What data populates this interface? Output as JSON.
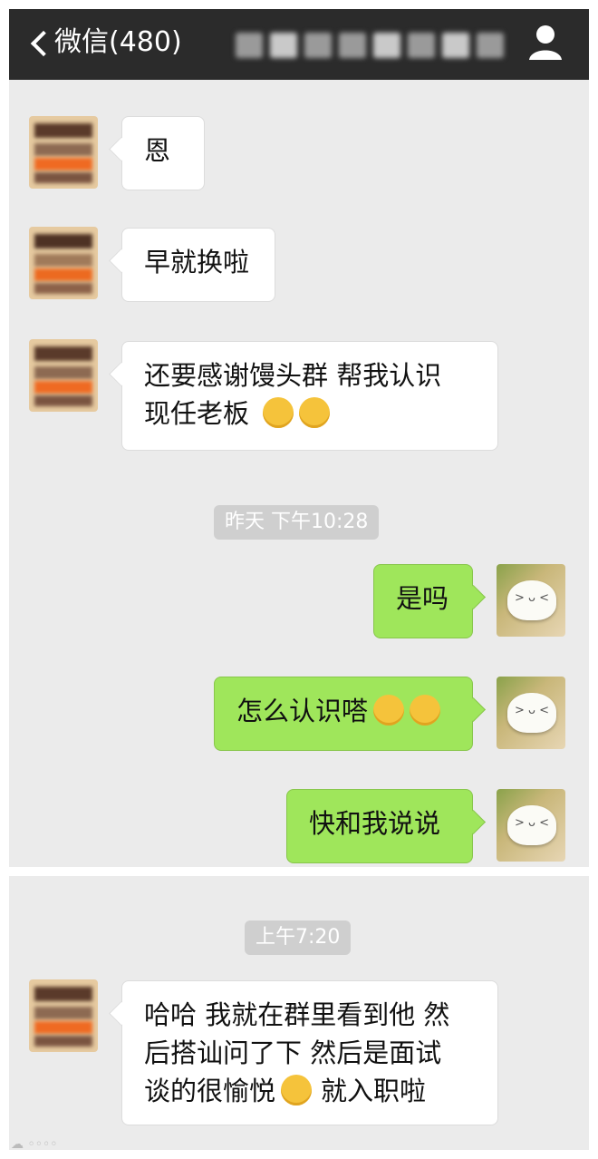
{
  "nav": {
    "back_label": "微信(480)",
    "icons": {
      "back": "chevron-left-icon",
      "profile": "user-icon"
    }
  },
  "messages": [
    {
      "side": "left",
      "text": "恩"
    },
    {
      "side": "left",
      "text": "早就换啦"
    },
    {
      "side": "left",
      "line1": "还要感谢馒头群 帮我认识",
      "line2": "现任老板",
      "emoji": [
        "winking-tongue-emoji",
        "winking-tongue-emoji"
      ]
    },
    {
      "side": "right",
      "text": "是吗"
    },
    {
      "side": "right",
      "text": "怎么认识嗒",
      "emoji": [
        "hug-emoji",
        "hug-emoji"
      ]
    },
    {
      "side": "right",
      "text": "快和我说说"
    },
    {
      "side": "left",
      "line1": "哈哈 我就在群里看到他 然",
      "line2": "后搭讪问了下 然后是面试",
      "line3a": "谈的很愉悦",
      "line3b": "就入职啦",
      "emoji": [
        "smile-emoji"
      ]
    }
  ],
  "timestamps": [
    "昨天 下午10:28",
    "上午7:20"
  ],
  "colors": {
    "nav_bg": "#2b2b2b",
    "chat_bg": "#ebebeb",
    "bubble_self": "#9fe65b",
    "bubble_other": "#ffffff"
  }
}
